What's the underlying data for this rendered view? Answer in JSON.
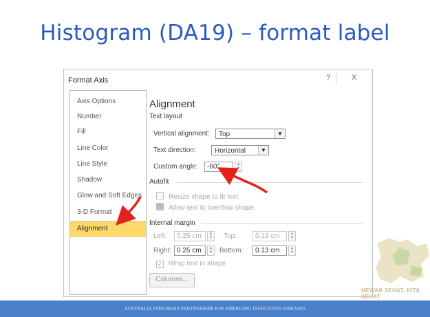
{
  "slide": {
    "title": "Histogram (DA19) – format label",
    "footer": "AUSTRALIA INDONESIA PARTNERSHIP FOR EMERGING INFECTIOUS DISEASES",
    "brand": "HEWAN SEHAT, KITA SEHAT"
  },
  "dialog": {
    "title": "Format Axis",
    "help": "?",
    "close": "X",
    "nav": [
      "Axis Options",
      "Number",
      "Fill",
      "Line Color",
      "Line Style",
      "Shadow",
      "Glow and Soft Edges",
      "3-D Format",
      "Alignment"
    ],
    "selected": "Alignment",
    "alignment": {
      "heading": "Alignment",
      "text_layout": "Text layout",
      "vertical_alignment_label": "Vertical alignment:",
      "vertical_alignment_value": "Top",
      "text_direction_label": "Text direction:",
      "text_direction_value": "Horizontal",
      "custom_angle_label": "Custom angle:",
      "custom_angle_value": "-60°",
      "autofit": "Autofit",
      "resize_shape": "Resize shape to fit text",
      "allow_overflow": "Allow text to overflow shape",
      "internal_margin": "Internal margin",
      "left_label": "Left:",
      "left_value": "0.25 cm",
      "top_label": "Top:",
      "top_value": "0.13 cm",
      "right_label": "Right:",
      "right_value": "0.25 cm",
      "bottom_label": "Bottom:",
      "bottom_value": "0.13 cm",
      "wrap_text": "Wrap text in shape",
      "columns_button": "Columns..."
    }
  },
  "colors": {
    "title": "#2b59c3",
    "selected_nav": "#ffd86a",
    "annotation_arrow": "#e0231f",
    "footer_bar": "#4a80c9"
  }
}
